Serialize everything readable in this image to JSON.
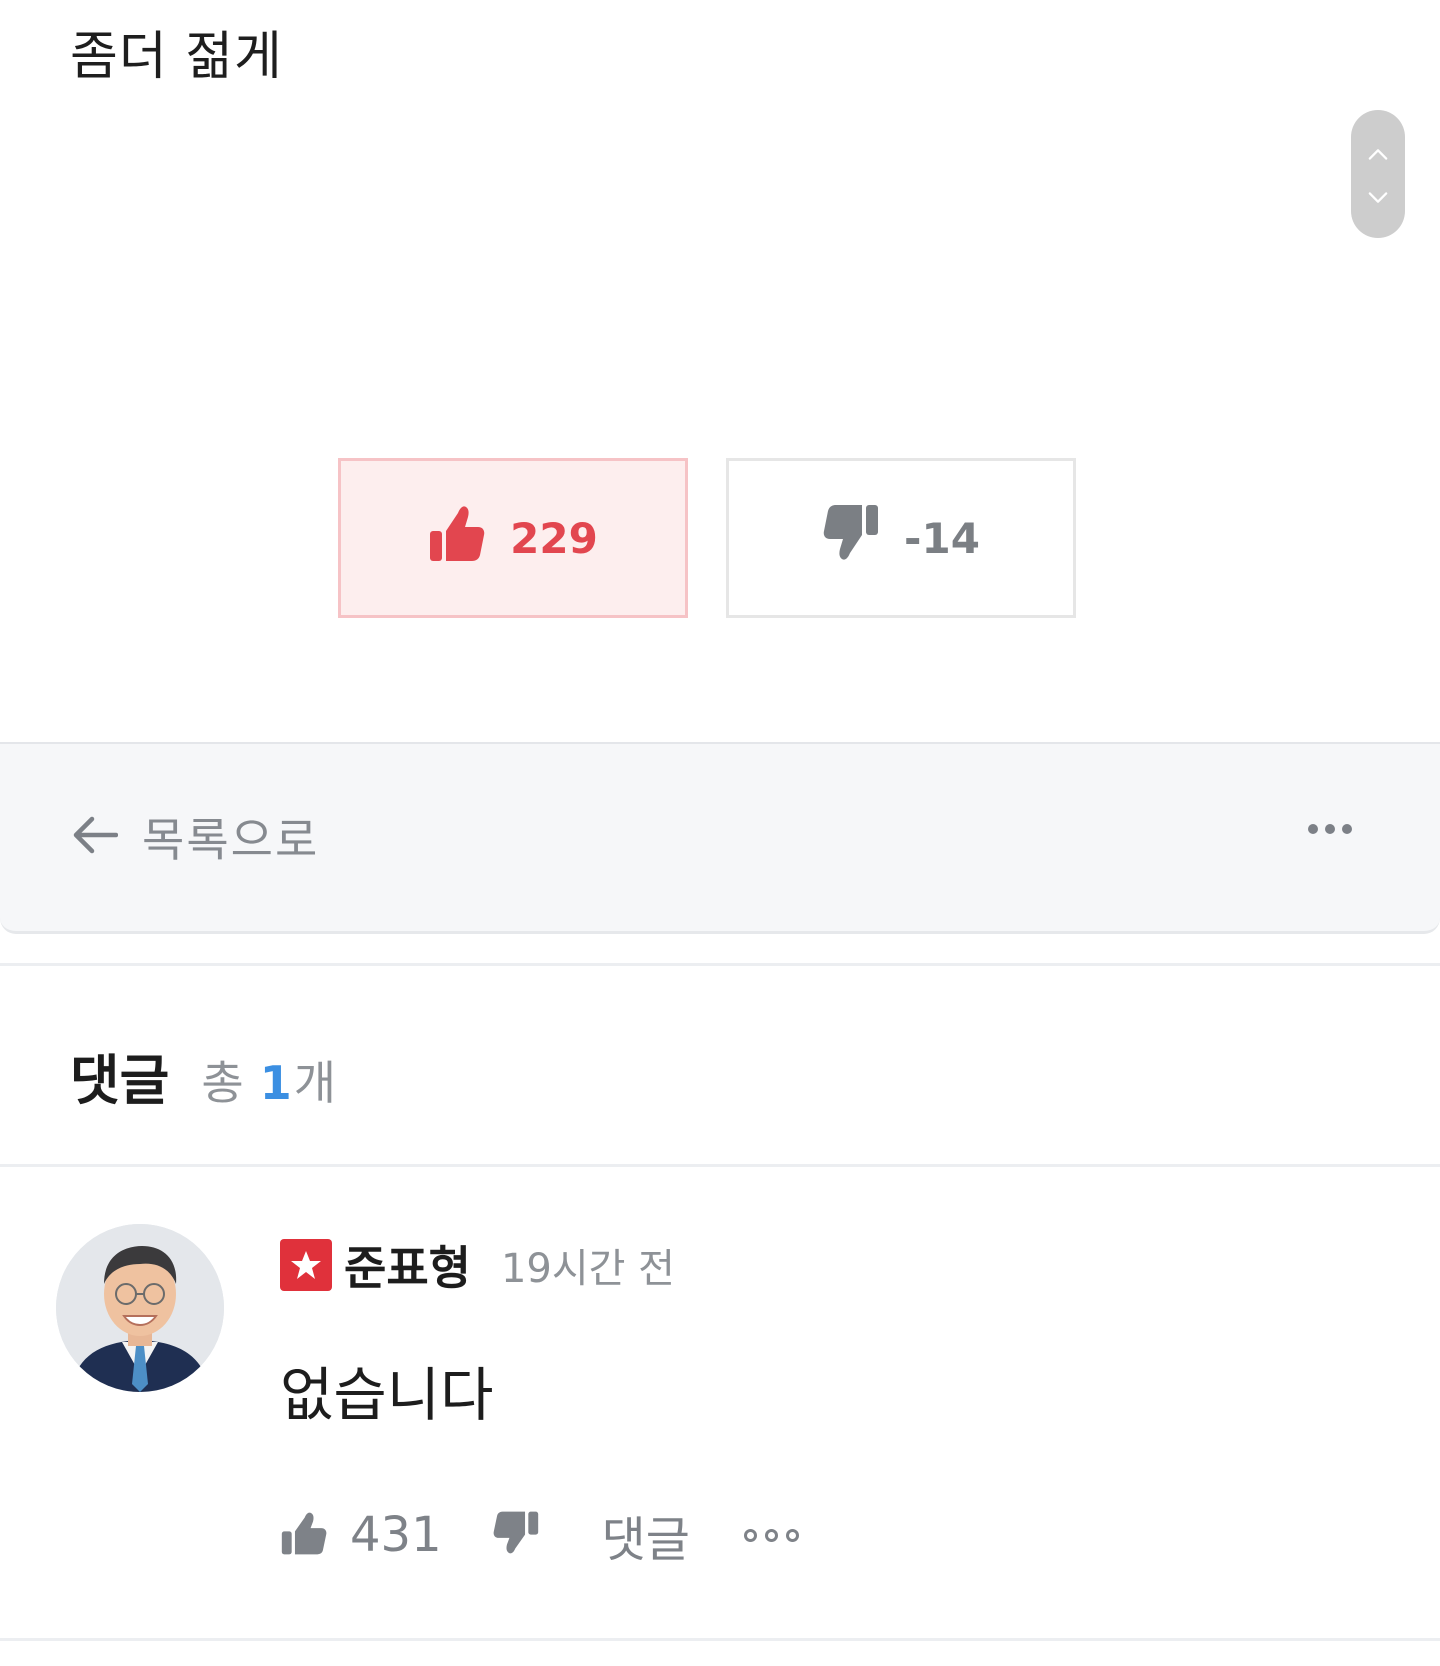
{
  "post": {
    "text": "좀더 젊게"
  },
  "scroll_nav": {
    "up_icon": "chevron-up-icon",
    "down_icon": "chevron-down-icon"
  },
  "votes": {
    "like_count": "229",
    "dislike_count": "-14",
    "like_color": "#e2464f",
    "dislike_color": "#7b7f84"
  },
  "actions": {
    "back_label": "목록으로",
    "back_icon": "arrow-left-icon",
    "more_icon": "more-dots-icon"
  },
  "comments": {
    "title": "댓글",
    "total_label": "총",
    "count": "1",
    "count_unit": "개",
    "count_color": "#3b8fe2",
    "items": [
      {
        "author": "준표형",
        "badge_icon": "star-badge-icon",
        "time": "19시간 전",
        "body": "없습니다",
        "like_count": "431",
        "reply_label": "댓글"
      }
    ]
  }
}
